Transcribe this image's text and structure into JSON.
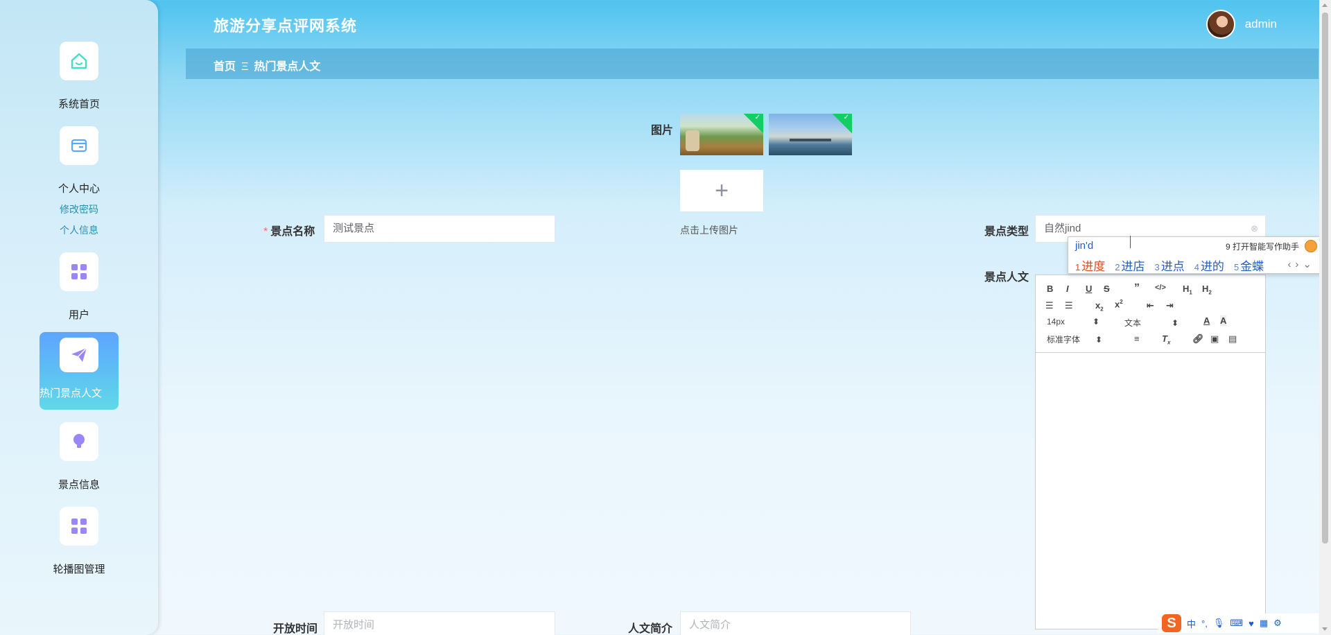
{
  "header": {
    "system_title": "旅游分享点评网系统",
    "username": "admin"
  },
  "breadcrumb": {
    "home": "首页",
    "separator": "Ξ",
    "current": "热门景点人文"
  },
  "sidebar": {
    "items": [
      {
        "label": "系统首页",
        "icon": "home-icon"
      },
      {
        "label": "个人中心",
        "icon": "wallet-icon"
      },
      {
        "label": "用户",
        "icon": "grid-icon"
      },
      {
        "label": "热门景点人文",
        "icon": "send-icon",
        "active": true
      },
      {
        "label": "景点信息",
        "icon": "bulb-icon"
      },
      {
        "label": "轮播图管理",
        "icon": "grid-icon"
      }
    ],
    "sub_links": [
      "修改密码",
      "个人信息"
    ]
  },
  "form": {
    "picture_label": "图片",
    "upload_hint": "点击上传图片",
    "name_label": "景点名称",
    "name_value": "测试景点",
    "type_label": "景点类型",
    "type_value": "自然jind",
    "culture_label": "景点人文",
    "open_time_label": "开放时间",
    "open_time_placeholder": "开放时间",
    "intro_label": "人文简介",
    "intro_placeholder": "人文简介"
  },
  "editor": {
    "font_size": "14px",
    "text_style": "文本",
    "font_family": "标准字体"
  },
  "ime": {
    "input": "jin'd",
    "tip": "9 打开智能写作助手",
    "candidates": [
      {
        "num": "1",
        "text": "进度"
      },
      {
        "num": "2",
        "text": "进店"
      },
      {
        "num": "3",
        "text": "进点"
      },
      {
        "num": "4",
        "text": "进的"
      },
      {
        "num": "5",
        "text": "金蝶"
      }
    ],
    "status_char": "中"
  },
  "colors": {
    "accent": "#4fc3ef",
    "active_nav_top": "#5ea4ff",
    "active_nav_bottom": "#5fd9e9",
    "required": "#f56c6c"
  }
}
